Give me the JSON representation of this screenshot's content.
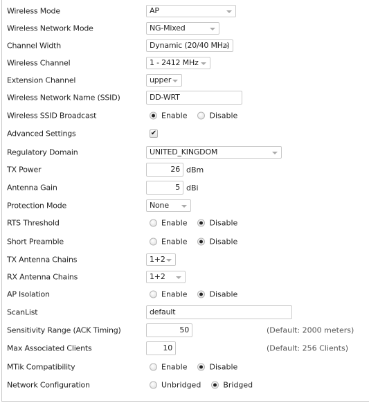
{
  "fields": {
    "wireless_mode": {
      "label": "Wireless Mode",
      "value": "AP"
    },
    "network_mode": {
      "label": "Wireless Network Mode",
      "value": "NG-Mixed"
    },
    "channel_width": {
      "label": "Channel Width",
      "value": "Dynamic (20/40 MHz)"
    },
    "wireless_channel": {
      "label": "Wireless Channel",
      "value": "1 - 2412 MHz"
    },
    "extension_channel": {
      "label": "Extension Channel",
      "value": "upper"
    },
    "ssid": {
      "label": "Wireless Network Name (SSID)",
      "value": "DD-WRT"
    },
    "ssid_broadcast": {
      "label": "Wireless SSID Broadcast",
      "option1": "Enable",
      "option2": "Disable",
      "selected": "Enable"
    },
    "advanced": {
      "label": "Advanced Settings",
      "checked": true,
      "check_glyph": "✔"
    },
    "regulatory_domain": {
      "label": "Regulatory Domain",
      "value": "UNITED_KINGDOM"
    },
    "tx_power": {
      "label": "TX Power",
      "value": "26",
      "unit": "dBm"
    },
    "antenna_gain": {
      "label": "Antenna Gain",
      "value": "5",
      "unit": "dBi"
    },
    "protection_mode": {
      "label": "Protection Mode",
      "value": "None"
    },
    "rts_threshold": {
      "label": "RTS Threshold",
      "option1": "Enable",
      "option2": "Disable",
      "selected": "Disable"
    },
    "short_preamble": {
      "label": "Short Preamble",
      "option1": "Enable",
      "option2": "Disable",
      "selected": "Disable"
    },
    "tx_chains": {
      "label": "TX Antenna Chains",
      "value": "1+2"
    },
    "rx_chains": {
      "label": "RX Antenna Chains",
      "value": "1+2"
    },
    "ap_isolation": {
      "label": "AP Isolation",
      "option1": "Enable",
      "option2": "Disable",
      "selected": "Disable"
    },
    "scanlist": {
      "label": "ScanList",
      "value": "default"
    },
    "sensitivity": {
      "label": "Sensitivity Range (ACK Timing)",
      "value": "50",
      "hint": "(Default: 2000 meters)"
    },
    "max_clients": {
      "label": "Max Associated Clients",
      "value": "10",
      "hint": "(Default: 256 Clients)"
    },
    "mtik": {
      "label": "MTik Compatibility",
      "option1": "Enable",
      "option2": "Disable",
      "selected": "Disable"
    },
    "net_config": {
      "label": "Network Configuration",
      "option1": "Unbridged",
      "option2": "Bridged",
      "selected": "Bridged"
    }
  }
}
